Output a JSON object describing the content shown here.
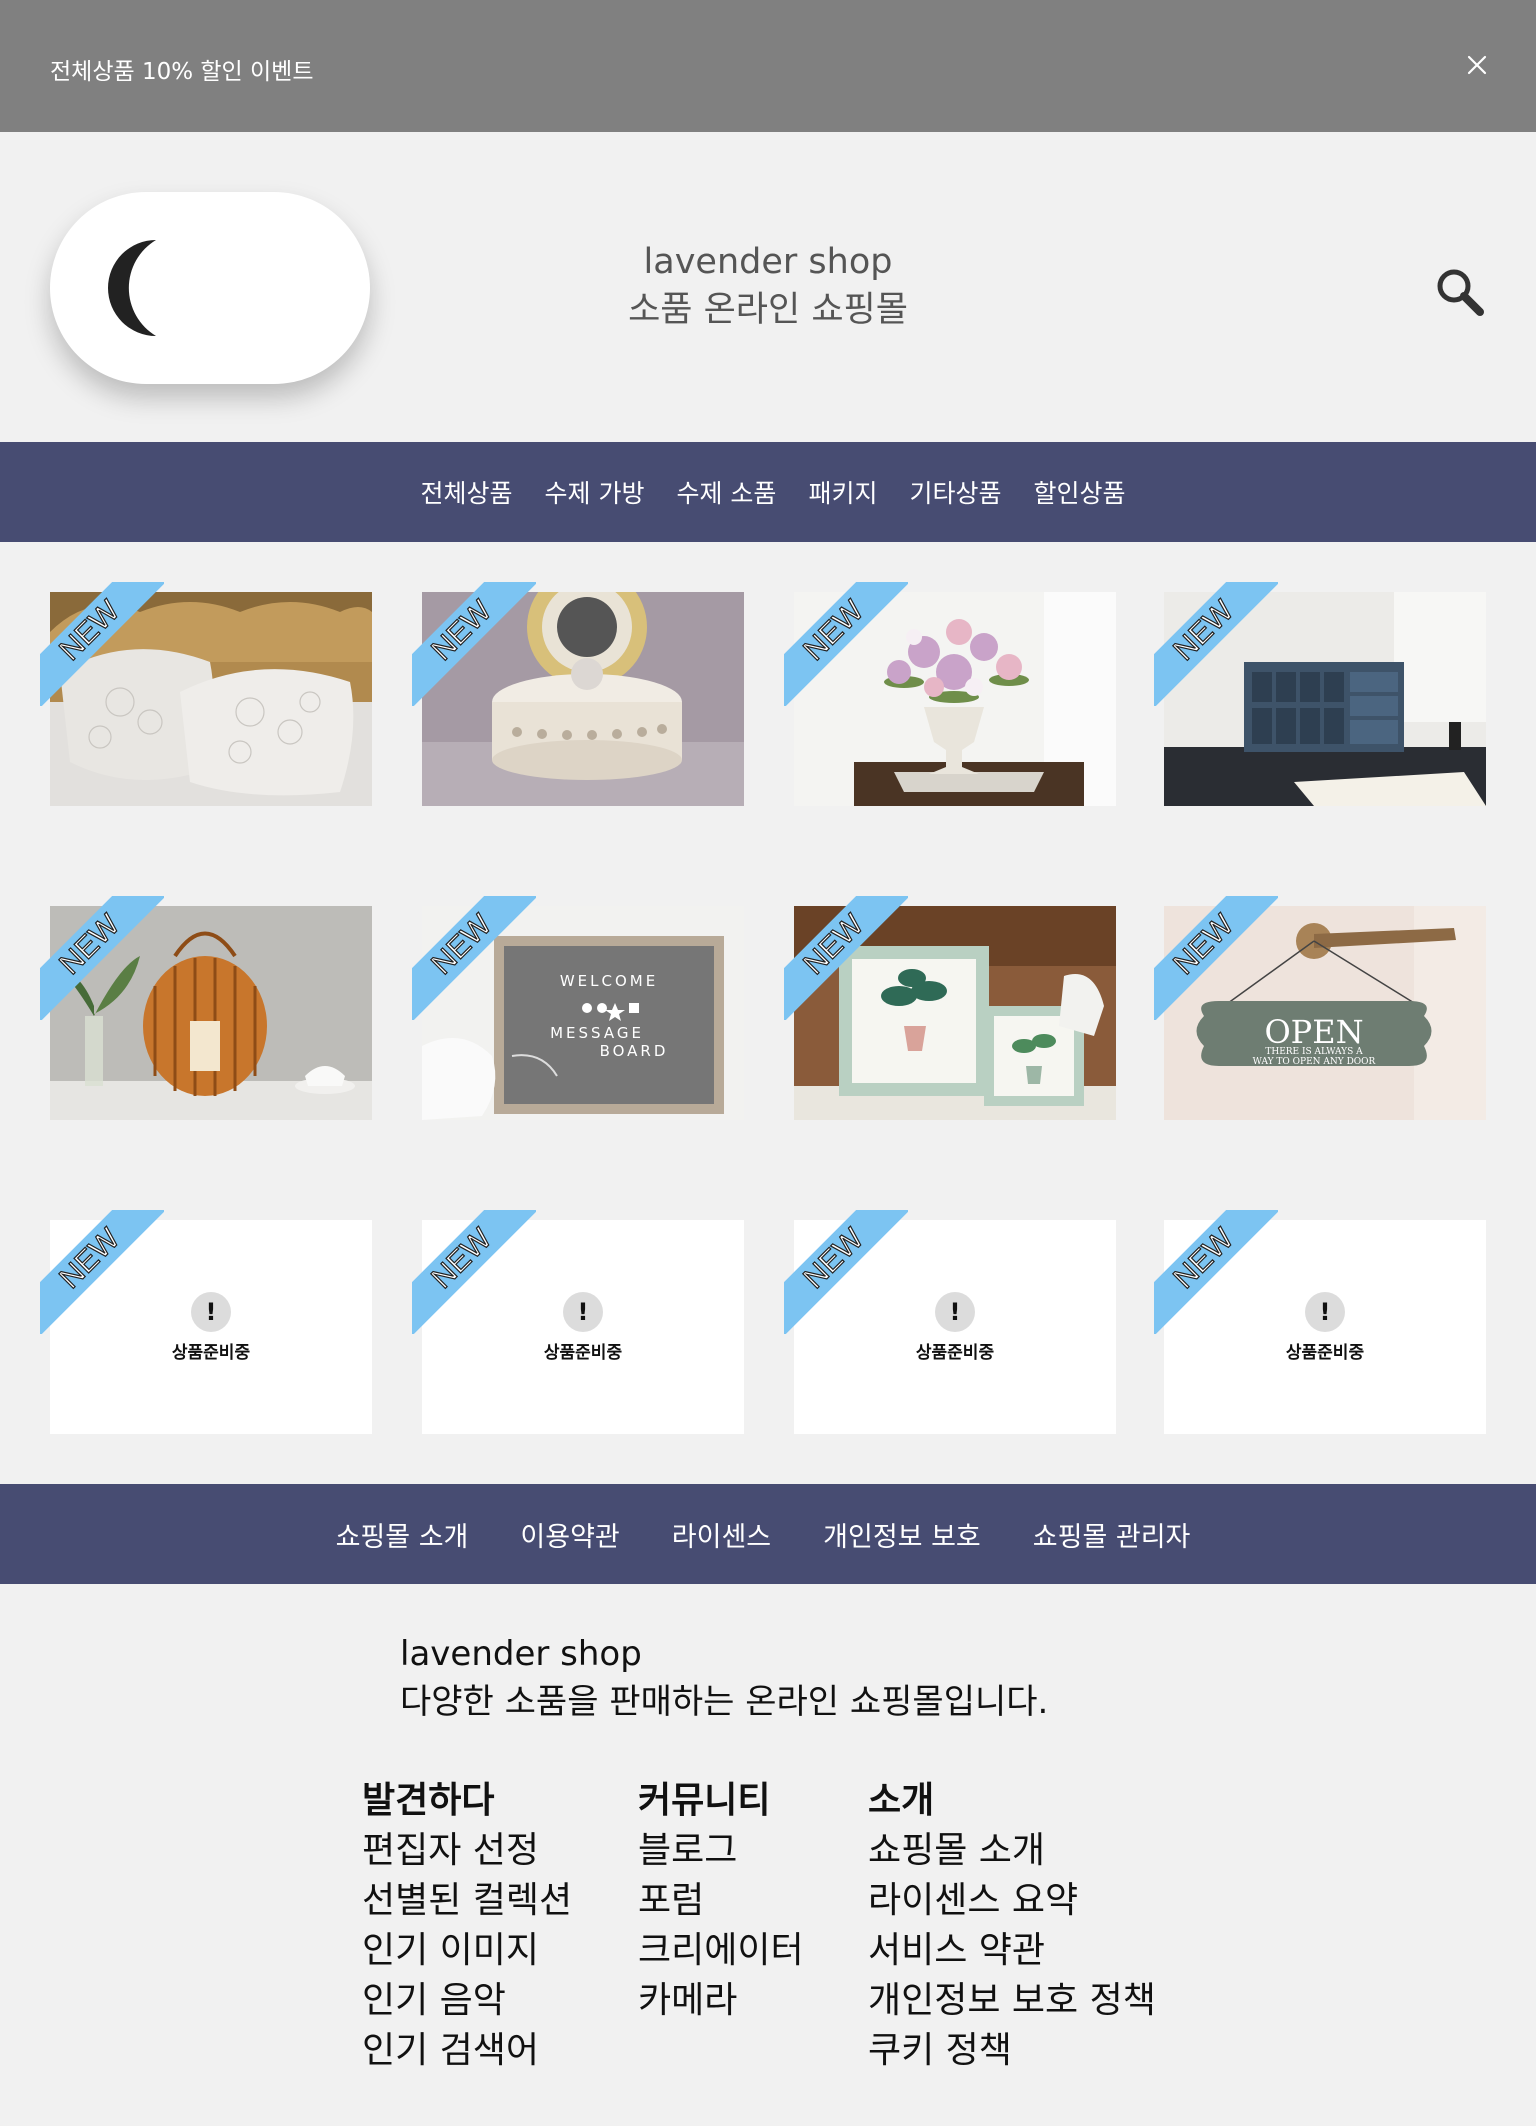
{
  "banner": {
    "text": "전체상품 10% 할인 이벤트",
    "close_icon": "close-icon"
  },
  "header": {
    "shop_name": "lavender shop",
    "tagline": "소품 온라인 쇼핑몰",
    "theme_toggle_icon": "moon-icon",
    "search_icon": "search-icon"
  },
  "nav": {
    "items": [
      "전체상품",
      "수제 가방",
      "수제 소품",
      "패키지",
      "기타상품",
      "할인상품"
    ]
  },
  "products": {
    "badge": "NEW",
    "pending_icon": "!",
    "pending_text": "상품준비중",
    "items": [
      {
        "image": "lace-pillows-photo",
        "status": "image"
      },
      {
        "image": "lace-jar-photo",
        "status": "image"
      },
      {
        "image": "flower-vase-photo",
        "status": "image"
      },
      {
        "image": "desk-organizer-photo",
        "status": "image"
      },
      {
        "image": "rattan-lantern-photo",
        "status": "image"
      },
      {
        "image": "welcome-board-photo",
        "status": "image"
      },
      {
        "image": "plant-frames-photo",
        "status": "image"
      },
      {
        "image": "open-sign-photo",
        "status": "image",
        "sign_title": "OPEN",
        "sign_sub1": "THERE IS ALWAYS A",
        "sign_sub2": "WAY TO OPEN ANY DOOR"
      },
      {
        "status": "pending"
      },
      {
        "status": "pending"
      },
      {
        "status": "pending"
      },
      {
        "status": "pending"
      }
    ],
    "board_text": {
      "line1": "WELCOME",
      "line2": "MESSAGE",
      "line3": "BOARD"
    }
  },
  "footer_nav": {
    "items": [
      "쇼핑몰 소개",
      "이용약관",
      "라이센스",
      "개인정보 보호",
      "쇼핑몰 관리자"
    ]
  },
  "footer": {
    "shop_name": "lavender shop",
    "description": "다양한 소품을 판매하는 온라인 쇼핑몰입니다.",
    "columns": [
      {
        "title": "발견하다",
        "links": [
          "편집자 선정",
          "선별된 컬렉션",
          "인기 이미지",
          "인기 음악",
          "인기 검색어"
        ]
      },
      {
        "title": "커뮤니티",
        "links": [
          "블로그",
          "포럼",
          "크리에이터",
          "카메라"
        ]
      },
      {
        "title": "소개",
        "links": [
          "쇼핑몰 소개",
          "라이센스 요약",
          "서비스 약관",
          "개인정보 보호 정책",
          "쿠키 정책"
        ]
      }
    ]
  },
  "colors": {
    "banner": "#808080",
    "nav": "#474c72",
    "ribbon": "#7cc4f2",
    "background": "#f1f1f1"
  }
}
